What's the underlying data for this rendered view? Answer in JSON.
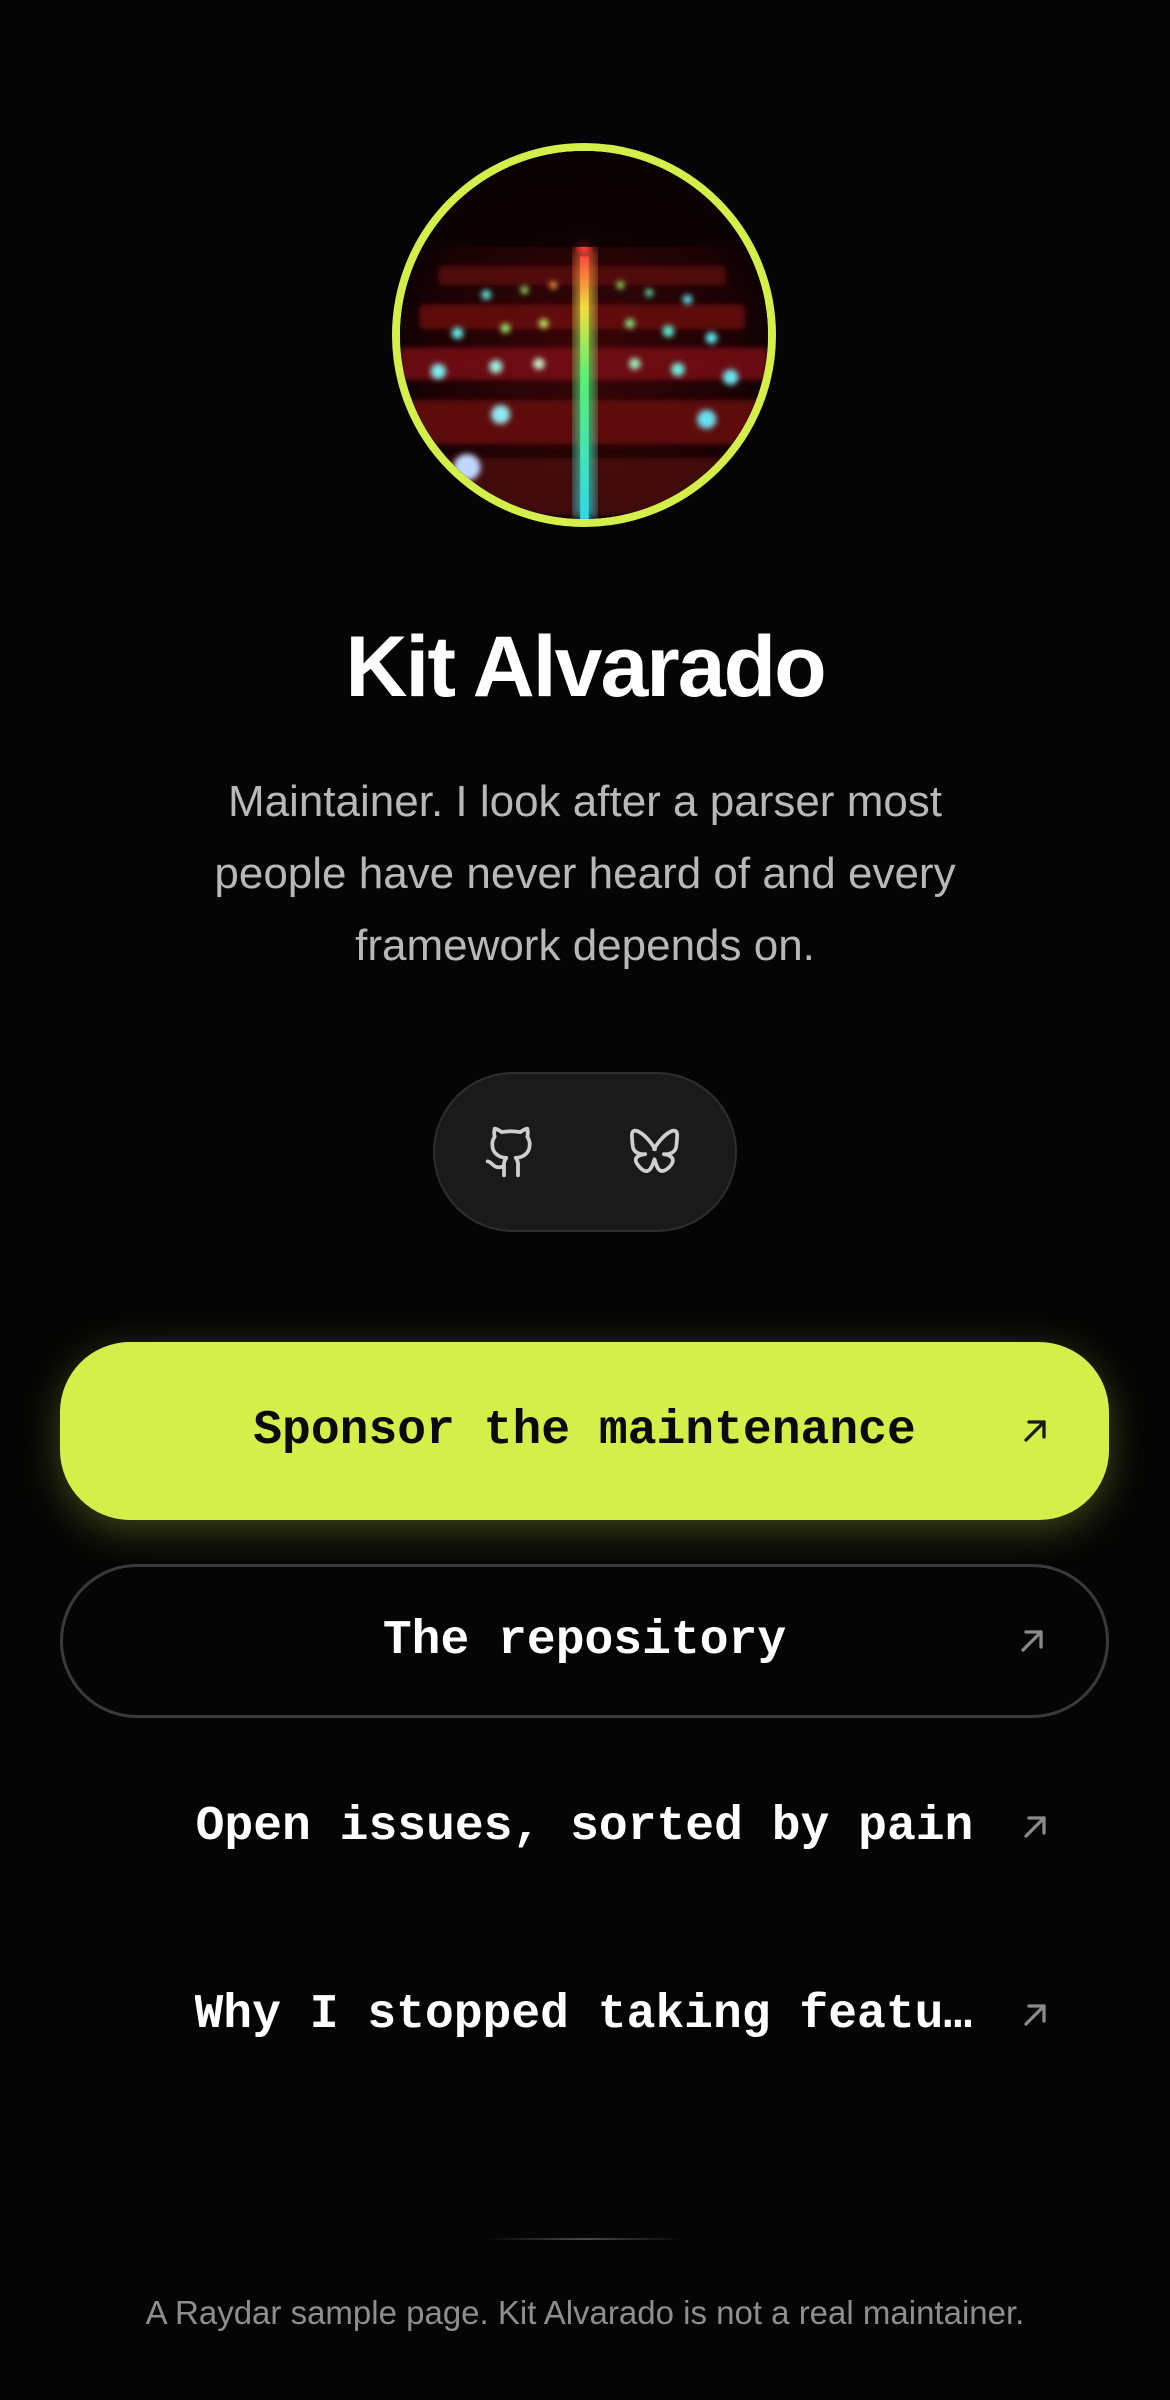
{
  "profile": {
    "name": "Kit Alvarado",
    "bio": "Maintainer. I look after a parser most people have never heard of and every framework depends on.",
    "avatar_icon": "keyboard-photo-avatar"
  },
  "social": {
    "items": [
      {
        "icon": "github-icon"
      },
      {
        "icon": "bluesky-icon"
      }
    ]
  },
  "links": {
    "sponsor": "Sponsor the maintenance",
    "repository": "The repository",
    "issues": "Open issues, sorted by pain",
    "feature": "Why I stopped taking feature…"
  },
  "footer": {
    "text": "A Raydar sample page. Kit Alvarado is not a real maintainer."
  },
  "colors": {
    "accent": "#d4ef4a",
    "background": "#050505",
    "muted_text": "#b8b8b8"
  }
}
